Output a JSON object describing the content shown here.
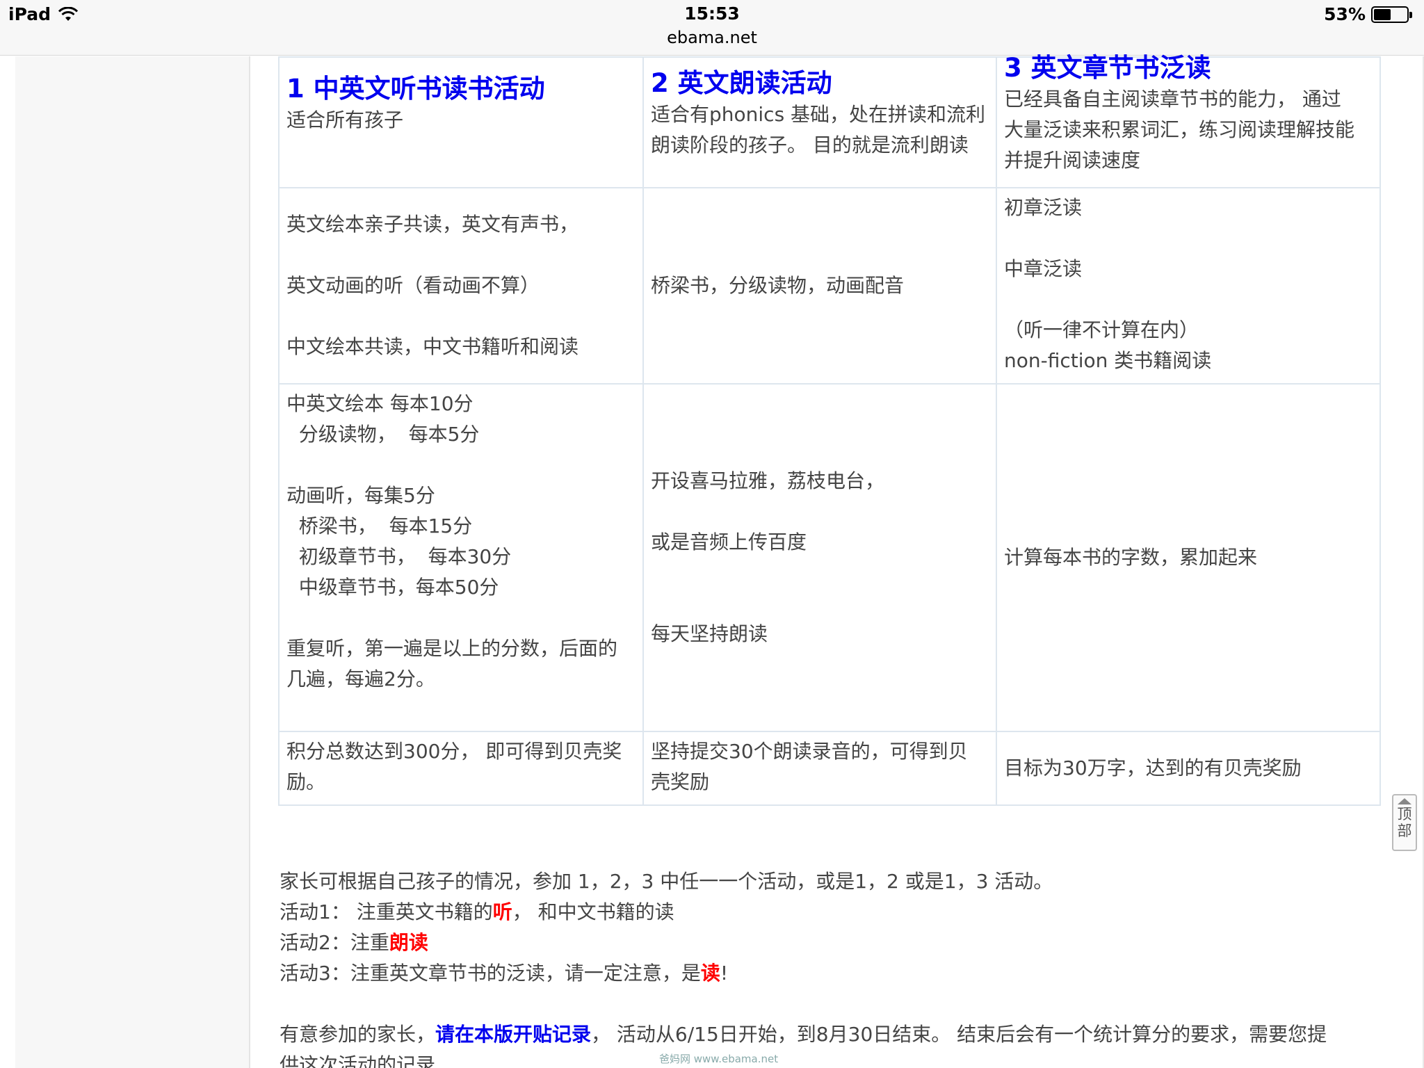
{
  "status_bar": {
    "device": "iPad",
    "time": "15:53",
    "url": "ebama.net",
    "battery": "53%",
    "battery_level": 0.53
  },
  "table": {
    "headers": [
      {
        "title": "1 中英文听书读书活动",
        "desc": [
          "适合所有孩子"
        ]
      },
      {
        "title": "2 英文朗读活动",
        "desc": [
          "适合有phonics 基础，处在拼读和流利",
          "朗读阶段的孩子。 目的就是流利朗读"
        ]
      },
      {
        "title": "3 英文章节书泛读",
        "desc": [
          "已经具备自主阅读章节书的能力， 通过",
          "大量泛读来积累词汇，练习阅读理解技能",
          "并提升阅读速度"
        ]
      }
    ],
    "row_content": [
      [
        "英文绘本亲子共读，英文有声书，",
        "",
        "英文动画的听（看动画不算）",
        "",
        "中文绘本共读，中文书籍听和阅读"
      ],
      [
        "桥梁书，分级读物，动画配音"
      ],
      [
        "初章泛读",
        "",
        "中章泛读",
        "",
        "（听一律不计算在内）",
        "non-fiction 类书籍阅读"
      ]
    ],
    "row_scoring": [
      [
        "中英文绘本 每本10分",
        "  分级读物，  每本5分",
        "",
        "动画听，每集5分",
        "  桥梁书，  每本15分",
        "  初级章节书，  每本30分",
        "  中级章节书，每本50分",
        "",
        "重复听，第一遍是以上的分数，后面的",
        "几遍，每遍2分。"
      ],
      [
        "开设喜马拉雅，荔枝电台，",
        "",
        "或是音频上传百度",
        "",
        "",
        "每天坚持朗读"
      ],
      [
        "计算每本书的字数，累加起来"
      ]
    ],
    "row_reward": [
      [
        "积分总数达到300分， 即可得到贝壳奖",
        "励。"
      ],
      [
        "坚持提交30个朗读录音的，可得到贝",
        "壳奖励"
      ],
      [
        "目标为30万字，达到的有贝壳奖励"
      ]
    ]
  },
  "back_to_top": {
    "line1": "顶",
    "line2": "部"
  },
  "notes": {
    "intro": "家长可根据自己孩子的情况，参加 1，2，3 中任一一个活动，或是1，2 或是1，3 活动。",
    "a1_pre": "活动1： 注重英文书籍的",
    "a1_hl": "听",
    "a1_post": "， 和中文书籍的读",
    "a2_pre": "活动2：注重",
    "a2_hl": "朗读",
    "a3_pre": "活动3：注重英文章节书的泛读，请一定注意，是",
    "a3_hl": "读",
    "a3_post": "!",
    "last_pre": "有意参加的家长，",
    "last_link": "请在本版开贴记录",
    "last_post": "， 活动从6/15日开始，到8月30日结束。 结束后会有一个统计算分的要求，需要您提",
    "last_cont": "供这次活动的记录"
  },
  "watermark": "爸妈网 www.ebama.net"
}
